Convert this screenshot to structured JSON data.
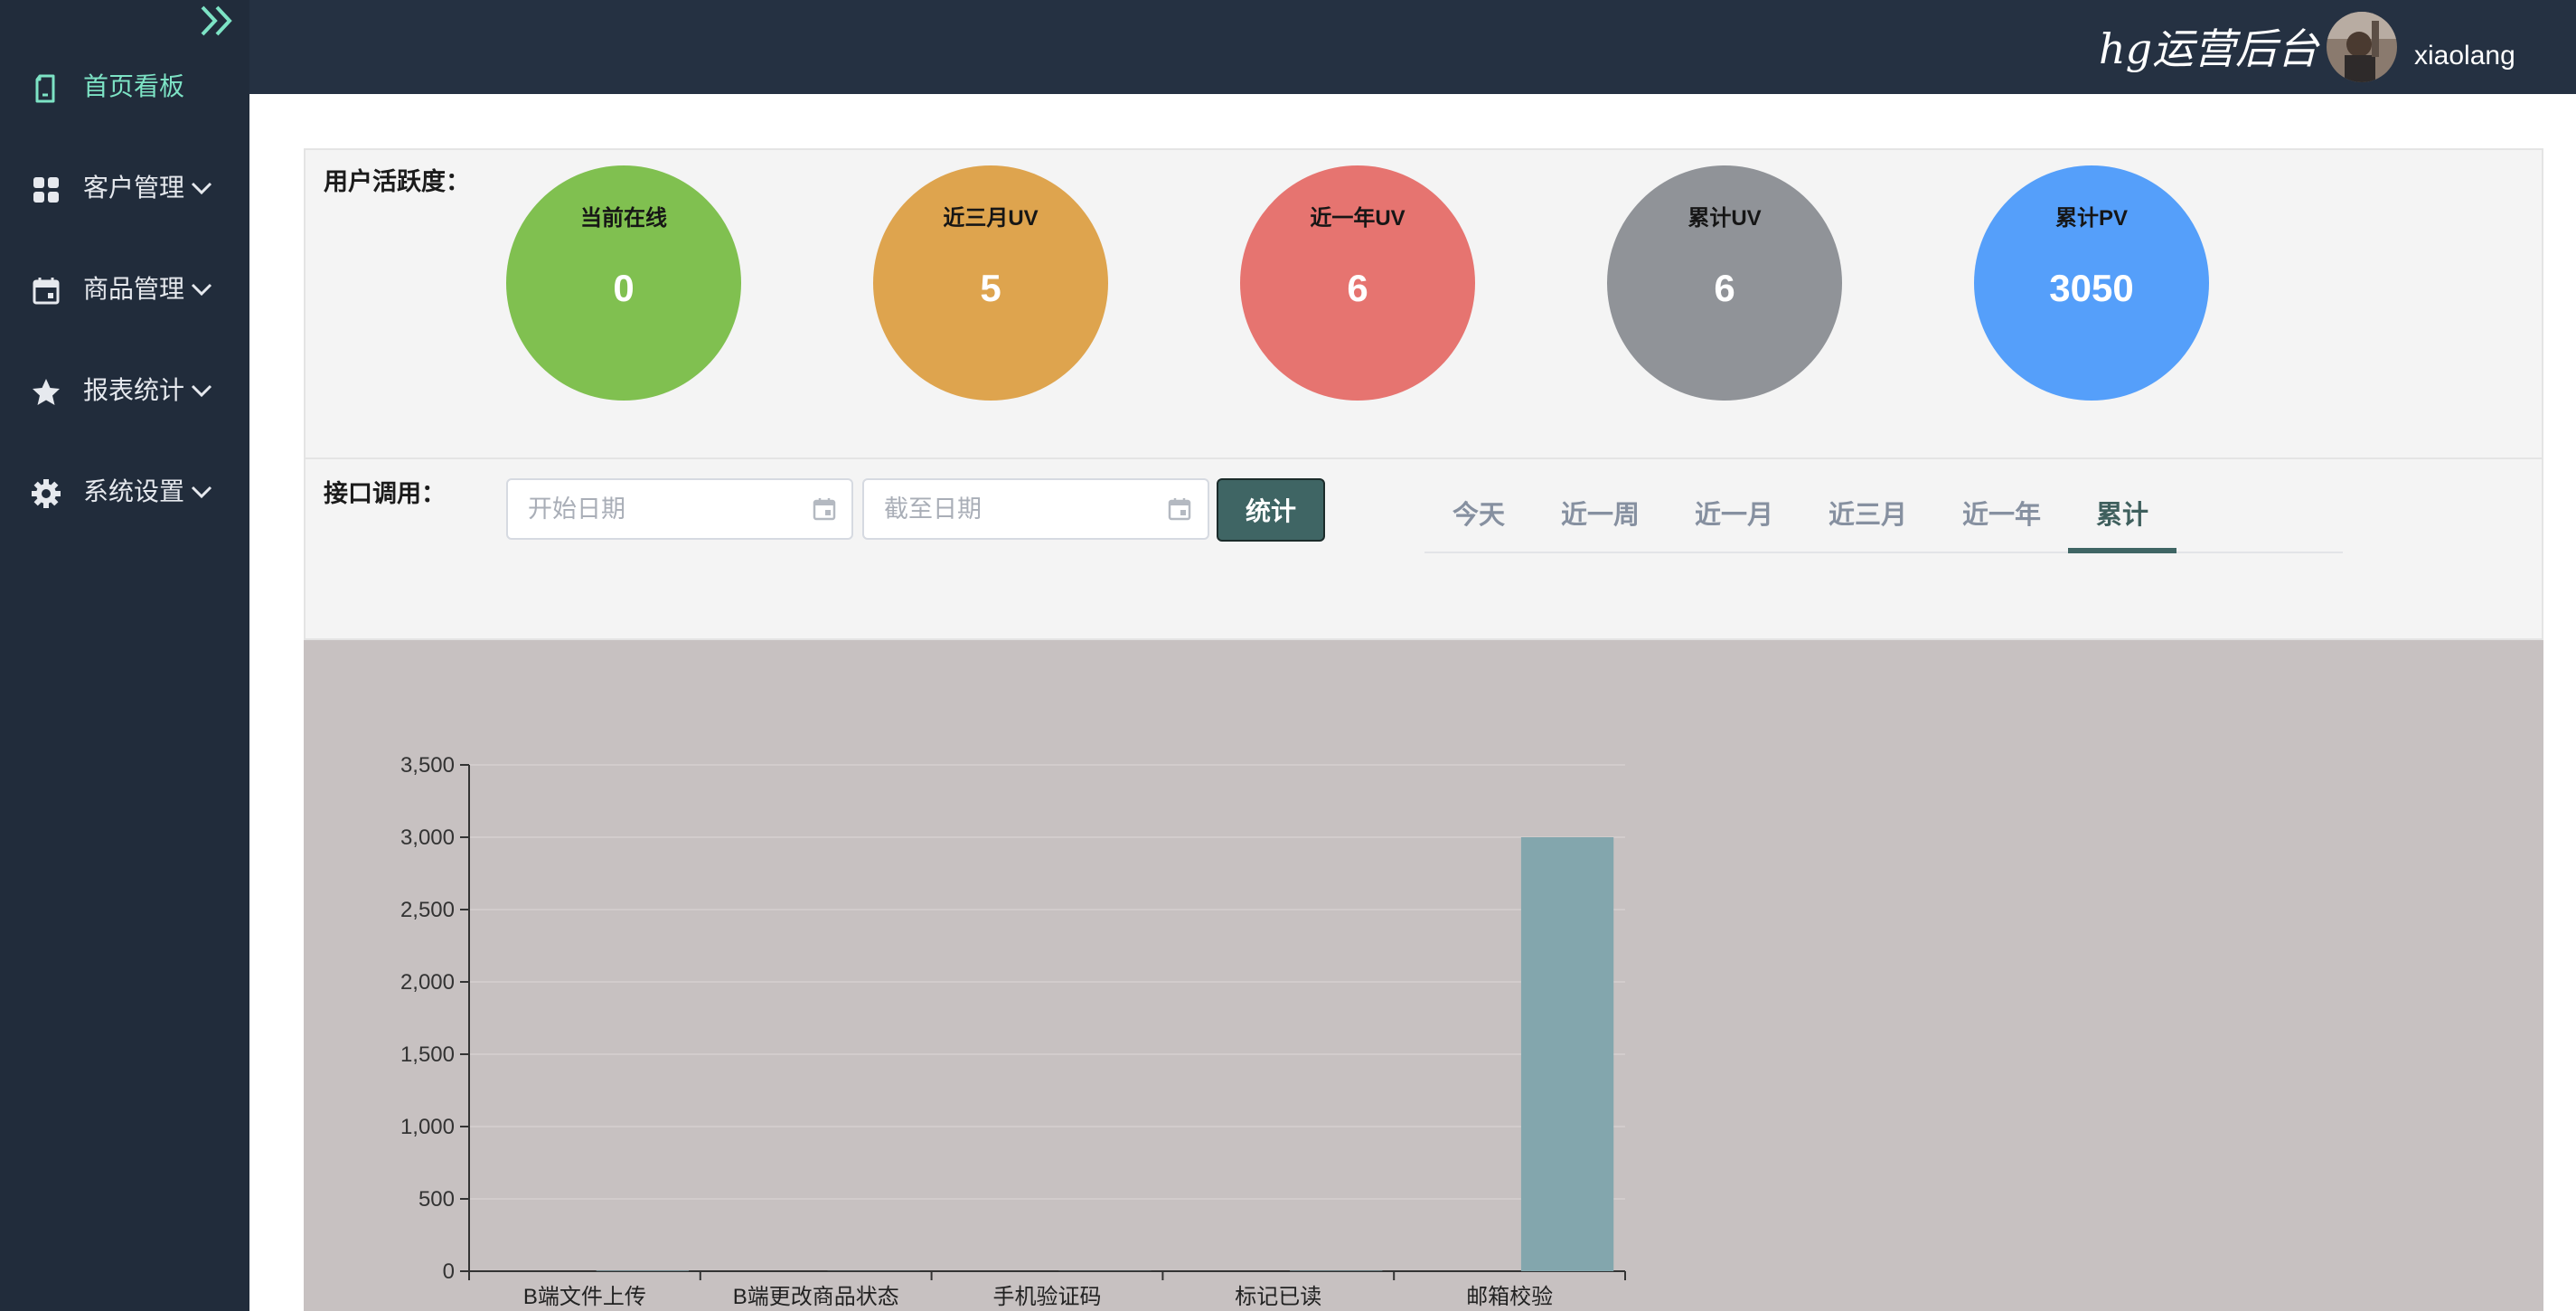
{
  "sidebar": {
    "items": [
      {
        "label": "首页看板",
        "icon": "document-icon"
      },
      {
        "label": "客户管理",
        "icon": "grid-icon"
      },
      {
        "label": "商品管理",
        "icon": "calendar-icon"
      },
      {
        "label": "报表统计",
        "icon": "star-icon"
      },
      {
        "label": "系统设置",
        "icon": "gear-icon"
      }
    ]
  },
  "header": {
    "brand": "hg运营后台",
    "username": "xiaolang"
  },
  "activity": {
    "label": "用户活跃度：",
    "stats": [
      {
        "title": "当前在线",
        "value": "0",
        "color": "#80c050"
      },
      {
        "title": "近三月UV",
        "value": "5",
        "color": "#dea44e"
      },
      {
        "title": "近一年UV",
        "value": "6",
        "color": "#e67470"
      },
      {
        "title": "累计UV",
        "value": "6",
        "color": "#909398"
      },
      {
        "title": "累计PV",
        "value": "3050",
        "color": "#559ffa"
      }
    ]
  },
  "api": {
    "label": "接口调用：",
    "start_placeholder": "开始日期",
    "end_placeholder": "截至日期",
    "submit_label": "统计",
    "tabs": [
      "今天",
      "近一周",
      "近一月",
      "近三月",
      "近一年",
      "累计"
    ],
    "active_tab": "累计"
  },
  "chart_data": {
    "type": "bar",
    "categories": [
      "B端文件上传",
      "B端更改商品状态",
      "手机验证码",
      "标记已读",
      "邮箱校验"
    ],
    "values": [
      4,
      1,
      1,
      3,
      3000
    ],
    "y_ticks": [
      "0",
      "500",
      "1,000",
      "1,500",
      "2,000",
      "2,500",
      "3,000",
      "3,500"
    ],
    "ylim": [
      0,
      3500
    ],
    "grid": true,
    "bar_color": "#83a6ad"
  }
}
